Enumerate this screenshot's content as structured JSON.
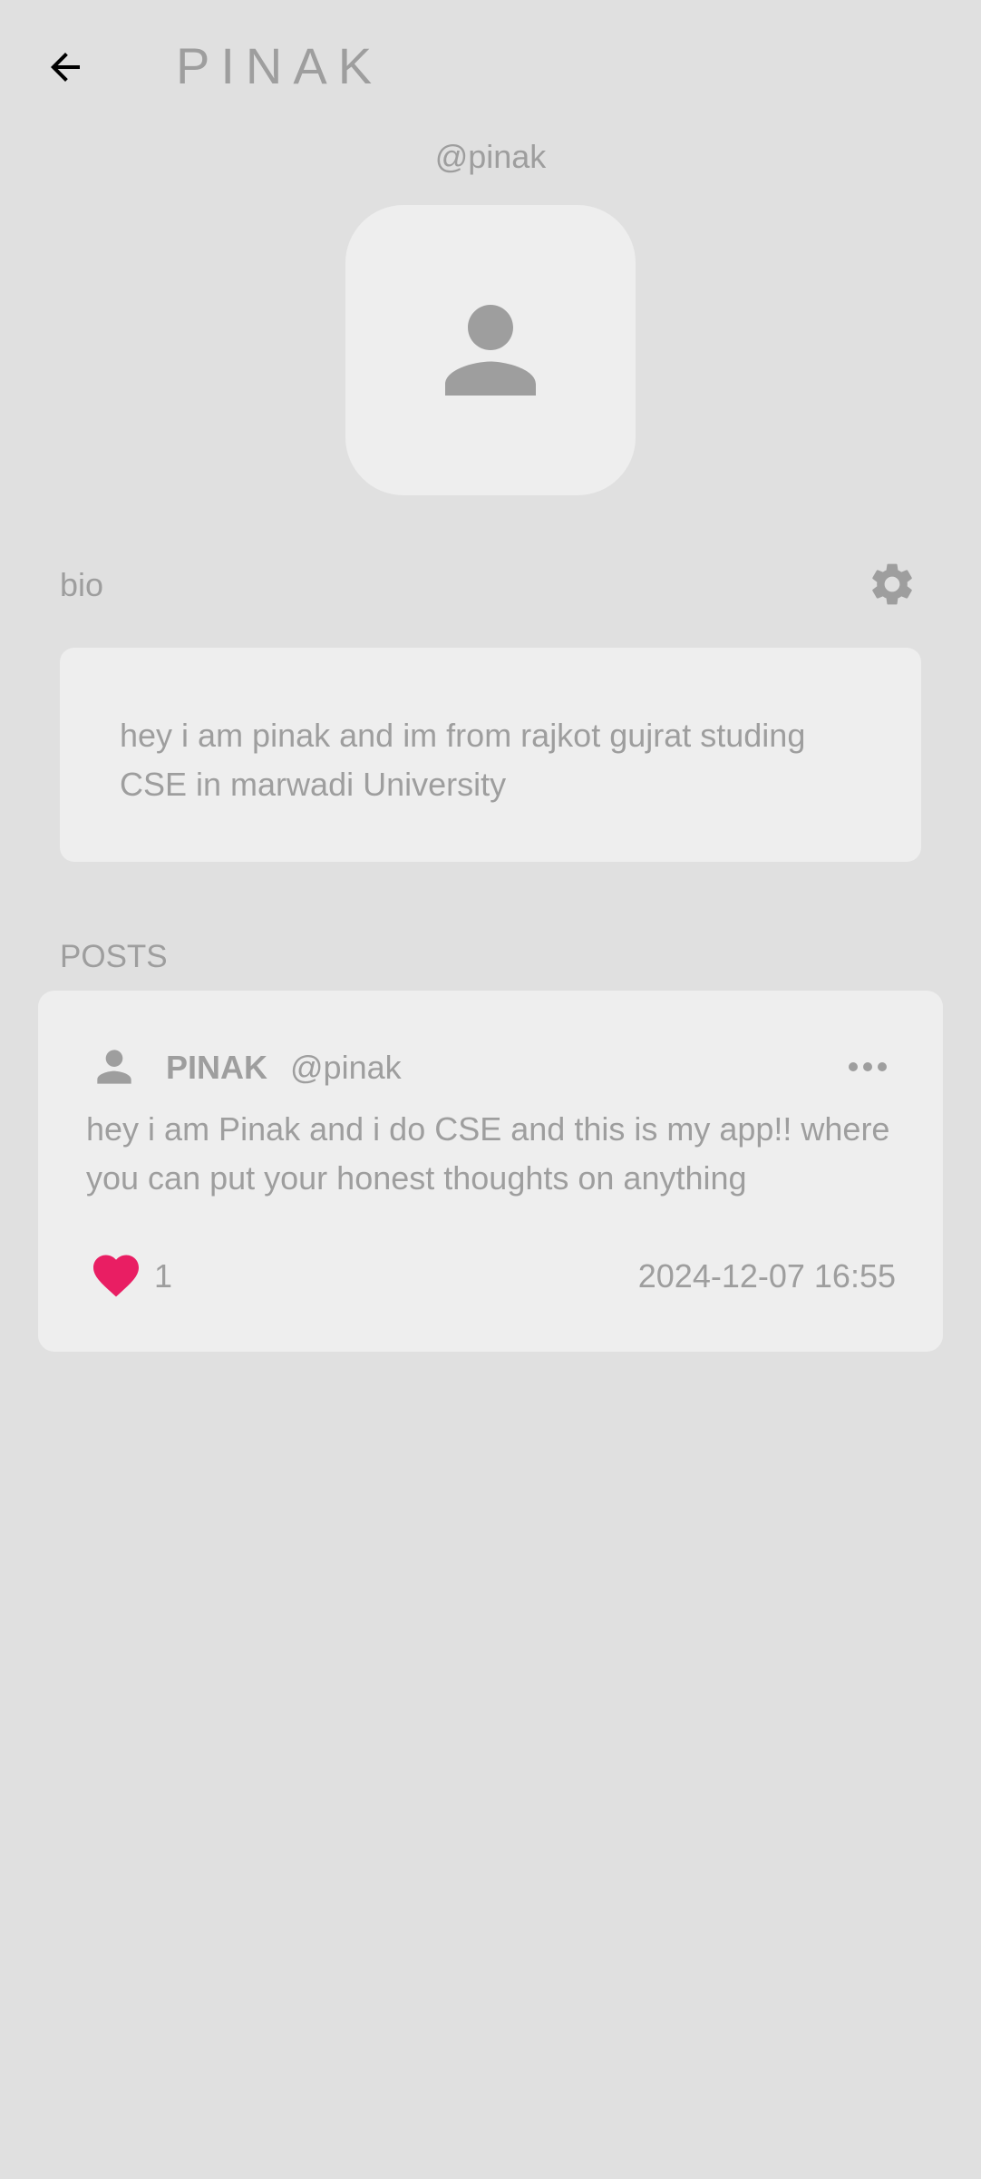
{
  "app_bar": {
    "title": "PINAK",
    "back_icon": "arrow-left-icon"
  },
  "profile": {
    "username": "@pinak",
    "avatar_icon": "person-icon"
  },
  "bio": {
    "label": "bio",
    "settings_icon": "gear-icon",
    "text": "hey i am pinak and im from rajkot gujrat studing CSE in marwadi University"
  },
  "posts": {
    "section_label": "POSTS",
    "items": [
      {
        "user_icon": "person-icon",
        "name": "PINAK",
        "handle": "@pinak",
        "more_icon": "more-horizontal-icon",
        "text": "hey i am Pinak and i do CSE and this is my app!! where you can put your honest thoughts on anything",
        "like_icon": "heart-icon",
        "likes": "1",
        "timestamp": "2024-12-07 16:55"
      }
    ]
  },
  "colors": {
    "background": "#e0e0e0",
    "card": "#eeeeee",
    "text_muted": "#9e9e9e",
    "like_accent": "#e91e63"
  }
}
